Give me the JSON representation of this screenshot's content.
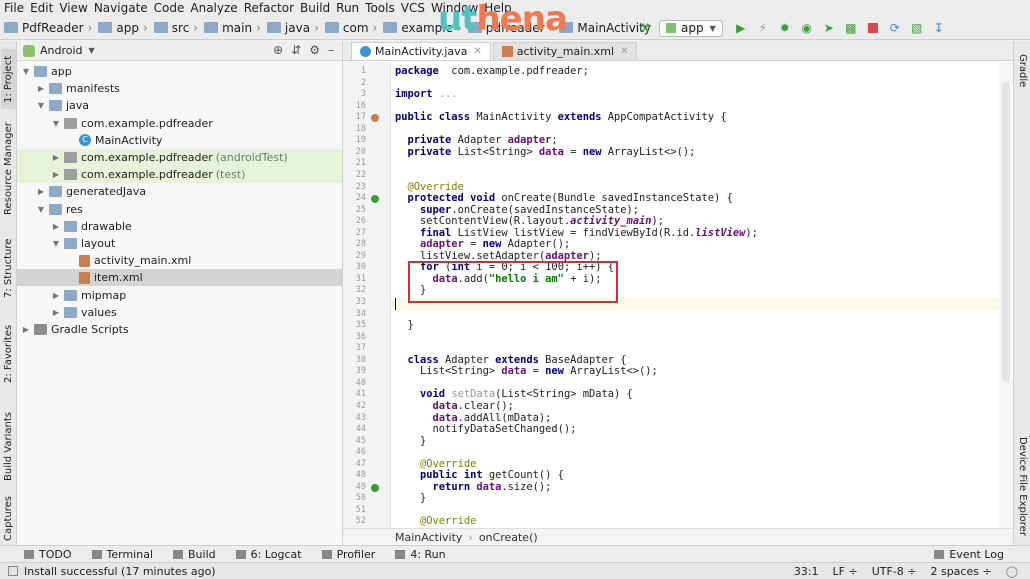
{
  "menu": [
    "File",
    "Edit",
    "View",
    "Navigate",
    "Code",
    "Analyze",
    "Refactor",
    "Build",
    "Run",
    "Tools",
    "VCS",
    "Window",
    "Help"
  ],
  "breadcrumbs": [
    "PdfReader",
    "app",
    "src",
    "main",
    "java",
    "com",
    "example",
    "pdfreader",
    "MainActivity"
  ],
  "logo": {
    "part1": "ut",
    "part2": "hena",
    "colors": {
      "a": "#4ec3c3",
      "b": "#f07a4d"
    }
  },
  "run_config": "app",
  "left_tabs": [
    "1: Project",
    "Resource Manager",
    "7: Structure",
    "2: Favorites",
    "Build Variants",
    "Captures"
  ],
  "right_tabs": [
    "Gradle",
    "Device File Explorer"
  ],
  "project": {
    "view": "Android",
    "tree": [
      {
        "label": "app",
        "depth": 0,
        "icon": "folder-icon",
        "expanded": true
      },
      {
        "label": "manifests",
        "depth": 1,
        "icon": "folder-icon",
        "expanded": false
      },
      {
        "label": "java",
        "depth": 1,
        "icon": "folder-icon",
        "expanded": true
      },
      {
        "label": "com.example.pdfreader",
        "depth": 2,
        "icon": "package-icon",
        "expanded": true
      },
      {
        "label": "MainActivity",
        "depth": 3,
        "icon": "class-icon"
      },
      {
        "label": "com.example.pdfreader",
        "suffix": "(androidTest)",
        "depth": 2,
        "icon": "package-icon",
        "expanded": false,
        "highlight": true
      },
      {
        "label": "com.example.pdfreader",
        "suffix": "(test)",
        "depth": 2,
        "icon": "package-icon",
        "expanded": false,
        "highlight": true
      },
      {
        "label": "generatedJava",
        "depth": 1,
        "icon": "folder-icon",
        "expanded": false
      },
      {
        "label": "res",
        "depth": 1,
        "icon": "folder-icon",
        "expanded": true
      },
      {
        "label": "drawable",
        "depth": 2,
        "icon": "folder-icon",
        "expanded": false
      },
      {
        "label": "layout",
        "depth": 2,
        "icon": "folder-icon",
        "expanded": true
      },
      {
        "label": "activity_main.xml",
        "depth": 3,
        "icon": "xml-file-icon"
      },
      {
        "label": "item.xml",
        "depth": 3,
        "icon": "xml-file-icon",
        "selected": true
      },
      {
        "label": "mipmap",
        "depth": 2,
        "icon": "folder-icon",
        "expanded": false
      },
      {
        "label": "values",
        "depth": 2,
        "icon": "folder-icon",
        "expanded": false
      },
      {
        "label": "Gradle Scripts",
        "depth": 0,
        "icon": "gradle-icon",
        "expanded": false
      }
    ]
  },
  "editor_tabs": [
    {
      "label": "MainActivity.java",
      "active": true,
      "icon": "class-icon"
    },
    {
      "label": "activity_main.xml",
      "active": false,
      "icon": "xml-file-icon"
    }
  ],
  "code_lines": [
    {
      "n": "1",
      "spans": [
        [
          "kw",
          "package"
        ],
        [
          "",
          "  com.example.pdfreader;"
        ]
      ]
    },
    {
      "n": "2",
      "spans": []
    },
    {
      "n": "3",
      "spans": [
        [
          "kw",
          "import"
        ],
        [
          "",
          " "
        ],
        [
          "mt",
          "..."
        ]
      ]
    },
    {
      "n": "16",
      "spans": []
    },
    {
      "n": "17",
      "spans": [
        [
          "kw",
          "public class"
        ],
        [
          "",
          " MainActivity "
        ],
        [
          "kw",
          "extends"
        ],
        [
          "",
          " AppCompatActivity {"
        ]
      ]
    },
    {
      "n": "18",
      "spans": []
    },
    {
      "n": "19",
      "spans": [
        [
          "",
          "  "
        ],
        [
          "kw",
          "private"
        ],
        [
          "",
          " Adapter "
        ],
        [
          "fld2",
          "adapter"
        ],
        [
          "",
          ";"
        ]
      ]
    },
    {
      "n": "20",
      "spans": [
        [
          "",
          "  "
        ],
        [
          "kw",
          "private"
        ],
        [
          "",
          " List<String> "
        ],
        [
          "fld2",
          "data"
        ],
        [
          "",
          " = "
        ],
        [
          "kw",
          "new"
        ],
        [
          "",
          " ArrayList<>();"
        ]
      ]
    },
    {
      "n": "21",
      "spans": []
    },
    {
      "n": "22",
      "spans": []
    },
    {
      "n": "23",
      "spans": [
        [
          "",
          "  "
        ],
        [
          "ann",
          "@Override"
        ]
      ]
    },
    {
      "n": "24",
      "spans": [
        [
          "",
          "  "
        ],
        [
          "kw",
          "protected void"
        ],
        [
          "",
          " onCreate(Bundle savedInstanceState) {"
        ]
      ]
    },
    {
      "n": "25",
      "spans": [
        [
          "",
          "    "
        ],
        [
          "kw",
          "super"
        ],
        [
          "",
          ".onCreate(savedInstanceState);"
        ]
      ]
    },
    {
      "n": "26",
      "spans": [
        [
          "",
          "    setContentView(R.layout."
        ],
        [
          "fld2 it",
          "activity_main"
        ],
        [
          "",
          ");"
        ]
      ]
    },
    {
      "n": "27",
      "spans": [
        [
          "",
          "    "
        ],
        [
          "kw",
          "final"
        ],
        [
          "",
          " ListView listView = findViewById(R.id."
        ],
        [
          "fld2 it",
          "listView"
        ],
        [
          "",
          ");"
        ]
      ]
    },
    {
      "n": "28",
      "spans": [
        [
          "",
          "    "
        ],
        [
          "fld2",
          "adapter"
        ],
        [
          "",
          " = "
        ],
        [
          "kw",
          "new"
        ],
        [
          "",
          " Adapter();"
        ]
      ]
    },
    {
      "n": "29",
      "spans": [
        [
          "",
          "    listView.setAdapter("
        ],
        [
          "fld2",
          "adapter"
        ],
        [
          "",
          ");"
        ]
      ]
    },
    {
      "n": "30",
      "spans": [
        [
          "",
          "    "
        ],
        [
          "kw",
          "for"
        ],
        [
          "",
          " ("
        ],
        [
          "kw",
          "int"
        ],
        [
          "",
          " i = 0; i < 100; i++) {"
        ]
      ]
    },
    {
      "n": "31",
      "spans": [
        [
          "",
          "      "
        ],
        [
          "fld2",
          "data"
        ],
        [
          "",
          ".add("
        ],
        [
          "str",
          "\"hello i am\""
        ],
        [
          "",
          " + i);"
        ]
      ]
    },
    {
      "n": "32",
      "spans": [
        [
          "",
          "    }"
        ]
      ]
    },
    {
      "n": "33",
      "spans": []
    },
    {
      "n": "34",
      "spans": []
    },
    {
      "n": "35",
      "spans": [
        [
          "",
          "  }"
        ]
      ]
    },
    {
      "n": "36",
      "spans": []
    },
    {
      "n": "37",
      "spans": []
    },
    {
      "n": "38",
      "spans": [
        [
          "",
          "  "
        ],
        [
          "kw",
          "class"
        ],
        [
          "",
          " Adapter "
        ],
        [
          "kw",
          "extends"
        ],
        [
          "",
          " BaseAdapter {"
        ]
      ]
    },
    {
      "n": "39",
      "spans": [
        [
          "",
          "    List<String> "
        ],
        [
          "fld2",
          "data"
        ],
        [
          "",
          " = "
        ],
        [
          "kw",
          "new"
        ],
        [
          "",
          " ArrayList<>();"
        ]
      ]
    },
    {
      "n": "40",
      "spans": []
    },
    {
      "n": "41",
      "spans": [
        [
          "",
          "    "
        ],
        [
          "kw",
          "void"
        ],
        [
          "",
          " "
        ],
        [
          "mt",
          "setData"
        ],
        [
          "",
          "(List<String> mData) {"
        ]
      ]
    },
    {
      "n": "42",
      "spans": [
        [
          "",
          "      "
        ],
        [
          "fld2",
          "data"
        ],
        [
          "",
          ".clear();"
        ]
      ]
    },
    {
      "n": "43",
      "spans": [
        [
          "",
          "      "
        ],
        [
          "fld2",
          "data"
        ],
        [
          "",
          ".addAll(mData);"
        ]
      ]
    },
    {
      "n": "44",
      "spans": [
        [
          "",
          "      notifyDataSetChanged();"
        ]
      ]
    },
    {
      "n": "45",
      "spans": [
        [
          "",
          "    }"
        ]
      ]
    },
    {
      "n": "46",
      "spans": []
    },
    {
      "n": "47",
      "spans": [
        [
          "",
          "    "
        ],
        [
          "ann",
          "@Override"
        ]
      ]
    },
    {
      "n": "48",
      "spans": [
        [
          "",
          "    "
        ],
        [
          "kw",
          "public int"
        ],
        [
          "",
          " getCount() {"
        ]
      ]
    },
    {
      "n": "49",
      "spans": [
        [
          "",
          "      "
        ],
        [
          "kw",
          "return"
        ],
        [
          "",
          " "
        ],
        [
          "fld2",
          "data"
        ],
        [
          "",
          ".size();"
        ]
      ]
    },
    {
      "n": "50",
      "spans": [
        [
          "",
          "    }"
        ]
      ]
    },
    {
      "n": "51",
      "spans": []
    },
    {
      "n": "52",
      "spans": [
        [
          "",
          "    "
        ],
        [
          "ann",
          "@Override"
        ]
      ]
    }
  ],
  "editor_breadcrumb": [
    "MainActivity",
    "onCreate()"
  ],
  "bottom_tools": [
    "TODO",
    "Terminal",
    "Build",
    "6: Logcat",
    "Profiler",
    "4: Run"
  ],
  "event_log": "Event Log",
  "status": {
    "message": "Install successful (17 minutes ago)",
    "position": "33:1",
    "line_sep": "LF ÷",
    "encoding": "UTF-8 ÷",
    "indent": "2 spaces ÷"
  }
}
